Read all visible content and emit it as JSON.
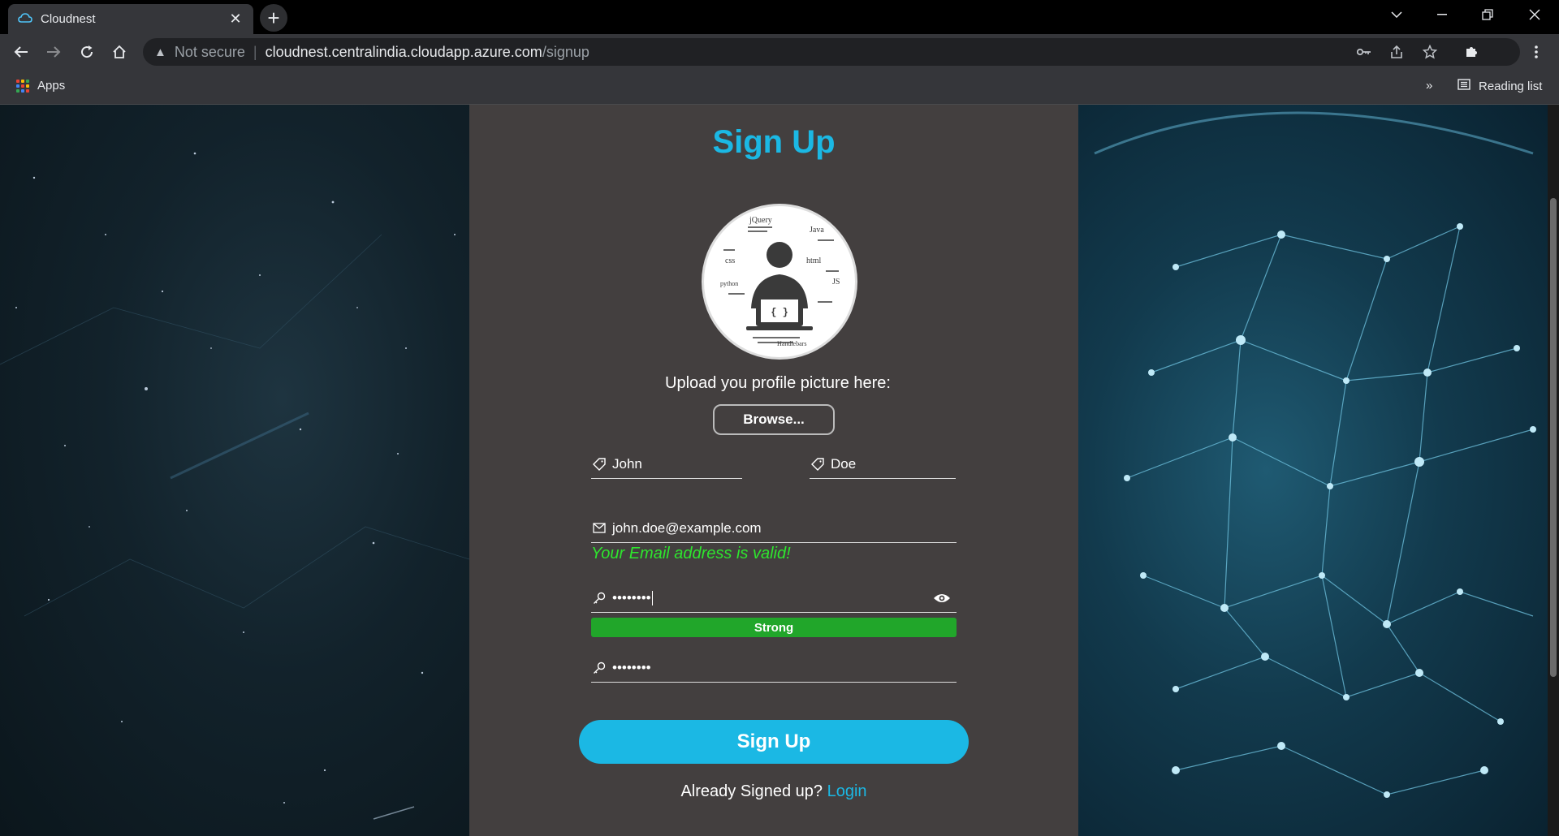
{
  "browser": {
    "tab_title": "Cloudnest",
    "tab_close": "✕",
    "new_tab": "+",
    "url_not_secure": "Not secure",
    "url_domain": "cloudnest.centralindia.cloudapp.azure.com",
    "url_path": "/signup",
    "bookmarks_apps": "Apps",
    "bookmarks_more": "»",
    "reading_list": "Reading list"
  },
  "signup": {
    "title": "Sign Up",
    "upload_label": "Upload you profile picture here:",
    "browse_button": "Browse...",
    "first_name_value": "John",
    "last_name_value": "Doe",
    "email_value": "john.doe@example.com",
    "email_status": "Your Email address is valid!",
    "password_value": "••••••••",
    "password_strength_label": "Strong",
    "password_strength_level": 1.0,
    "confirm_password_value": "••••••••",
    "submit_button": "Sign Up",
    "already_text": "Already Signed up?",
    "login_link": "Login"
  },
  "avatar_labels": [
    "jQuery",
    "Java",
    "css",
    "html",
    "python",
    "JS",
    "Handlebars",
    "{ }"
  ],
  "colors": {
    "accent": "#1bb8e4",
    "valid": "#2ee62e",
    "strong": "#21a62a",
    "panel": "#433f3f"
  }
}
